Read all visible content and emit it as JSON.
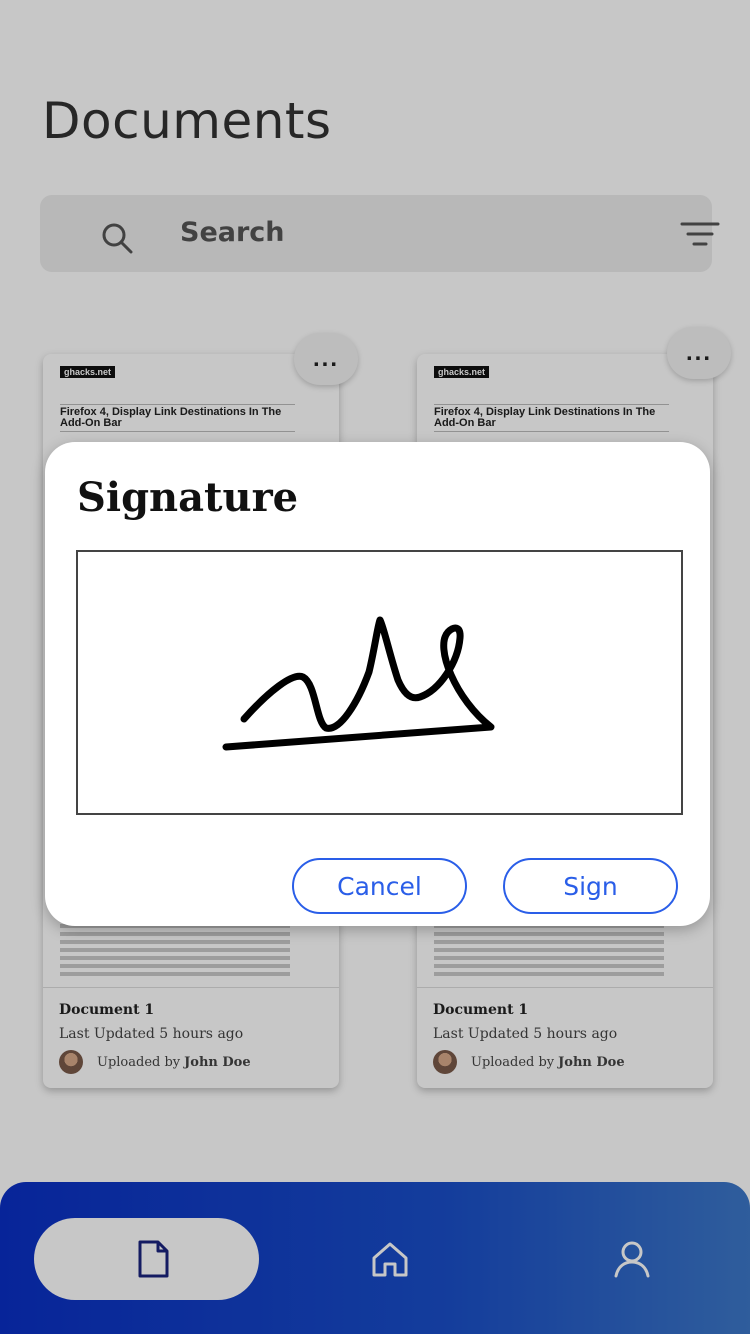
{
  "page": {
    "title": "Documents"
  },
  "search": {
    "placeholder": "Search"
  },
  "documents": [
    {
      "thumb_site": "ghacks.net",
      "thumb_headline": "Firefox 4, Display Link Destinations In The Add-On Bar",
      "name": "Document 1",
      "updated": "Last Updated 5 hours ago",
      "uploaded_prefix": "Uploaded by",
      "uploader": "John Doe",
      "more": "..."
    },
    {
      "thumb_site": "ghacks.net",
      "thumb_headline": "Firefox 4, Display Link Destinations In The Add-On Bar",
      "name": "Document 1",
      "updated": "Last Updated 5 hours ago",
      "uploaded_prefix": "Uploaded by",
      "uploader": "John Doe",
      "more": "..."
    }
  ],
  "dialog": {
    "title": "Signature",
    "cancel_label": "Cancel",
    "sign_label": "Sign"
  },
  "bottom_nav": {
    "items": [
      {
        "icon": "document-icon",
        "active": true
      },
      {
        "icon": "home-icon",
        "active": false
      },
      {
        "icon": "user-icon",
        "active": false
      }
    ]
  },
  "colors": {
    "accent": "#2a5ee8",
    "nav_gradient_start": "#0a2fc4",
    "nav_gradient_end": "#3d78c8",
    "overlay": "rgba(0,0,0,0.22)"
  }
}
